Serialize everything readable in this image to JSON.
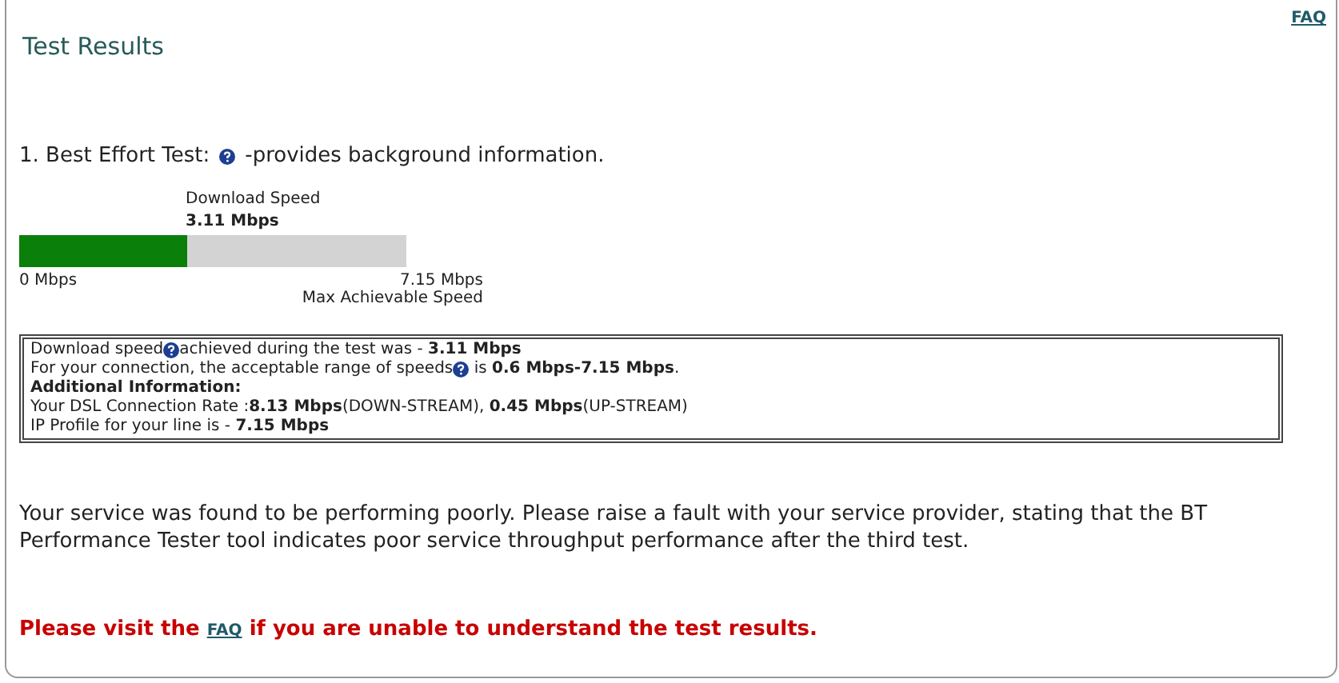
{
  "faq_link": "FAQ",
  "title": "Test Results",
  "test": {
    "label": "1. Best Effort Test:",
    "help_text": "-provides background information."
  },
  "meter": {
    "caption": "Download  Speed",
    "reading": "3.11 Mbps",
    "level": 0.435,
    "min_label": "0 Mbps",
    "max_label": "7.15 Mbps",
    "max_caption": "Max Achievable Speed"
  },
  "info_lines": [
    {
      "before": "Download speed",
      "help": true,
      "after": "achieved during the test was - **3.11 Mbps**"
    },
    {
      "before": "For your connection, the acceptable range of speeds",
      "help": true,
      "after": " is **0.6 Mbps-7.15 Mbps**."
    },
    {
      "before": "**Additional Information:**",
      "help": false
    },
    {
      "before": "Your DSL Connection Rate :**8.13 Mbps**(DOWN-STREAM), **0.45 Mbps**(UP-STREAM)",
      "help": false
    },
    {
      "before": "IP Profile for your line is - **7.15 Mbps**",
      "help": false
    }
  ],
  "message": "Your service was found to be performing poorly. Please raise a fault with your service provider, stating that the BT Performance Tester tool indicates poor service throughput performance after the third test.",
  "notice": {
    "before": "Please visit the",
    "link": "FAQ",
    "after": "if you are unable to understand the test results."
  }
}
